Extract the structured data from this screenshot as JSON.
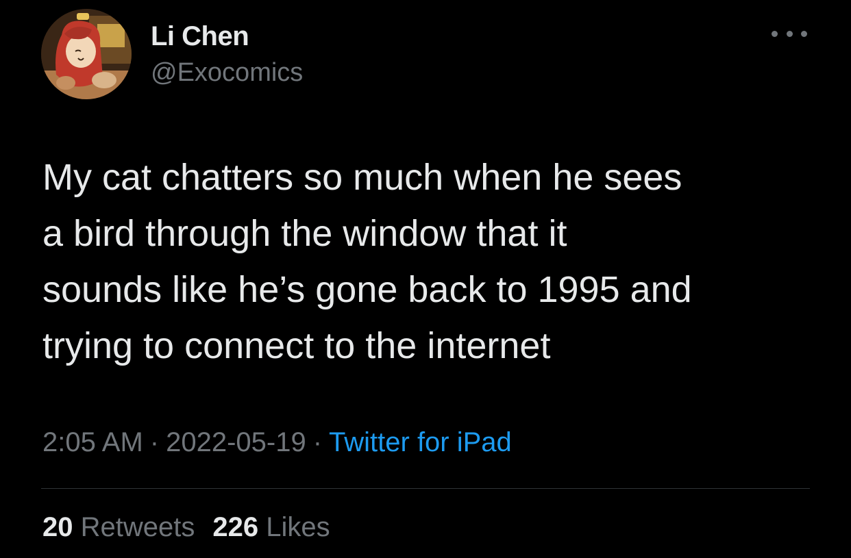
{
  "author": {
    "name": "Li Chen",
    "handle": "@Exocomics",
    "avatar_icon": "profile-avatar-illustration"
  },
  "tweet": {
    "text": "My cat chatters so much when he sees\na bird through the window that it\nsounds like he’s gone back to 1995 and\ntrying to connect to the internet",
    "time": "2:05 AM",
    "separator": "·",
    "date": "2022-05-19",
    "source": "Twitter for iPad"
  },
  "stats": {
    "retweets_count": "20",
    "retweets_label": "Retweets",
    "likes_count": "226",
    "likes_label": "Likes"
  },
  "colors": {
    "background": "#000000",
    "primary_text": "#e7e9ea",
    "secondary_text": "#71767b",
    "link": "#1d9bf0",
    "divider": "#2f3336"
  }
}
